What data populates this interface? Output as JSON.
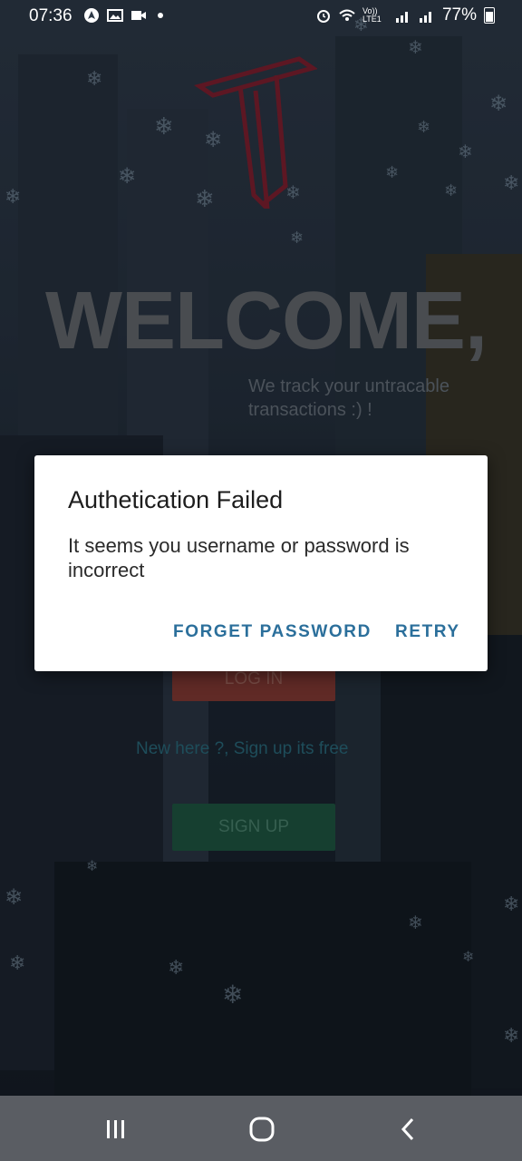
{
  "status_bar": {
    "time": "07:36",
    "battery": "77%",
    "network": "Vo)) LTE1"
  },
  "app": {
    "welcome": "WELCOME,",
    "tagline": "We track your untracable transactions :) !",
    "login_label": "LOG IN",
    "signup_prompt": "New here ?,  Sign up its free",
    "signup_label": "SIGN UP",
    "logo_color": "#8a1c2b"
  },
  "dialog": {
    "title": "Authetication Failed",
    "message": "It seems you username or password is incorrect",
    "forget_label": "FORGET PASSWORD",
    "retry_label": "RETRY",
    "accent": "#2b6f9b"
  },
  "nav": {
    "recent": "recent-apps-icon",
    "home": "home-icon",
    "back": "back-icon"
  }
}
